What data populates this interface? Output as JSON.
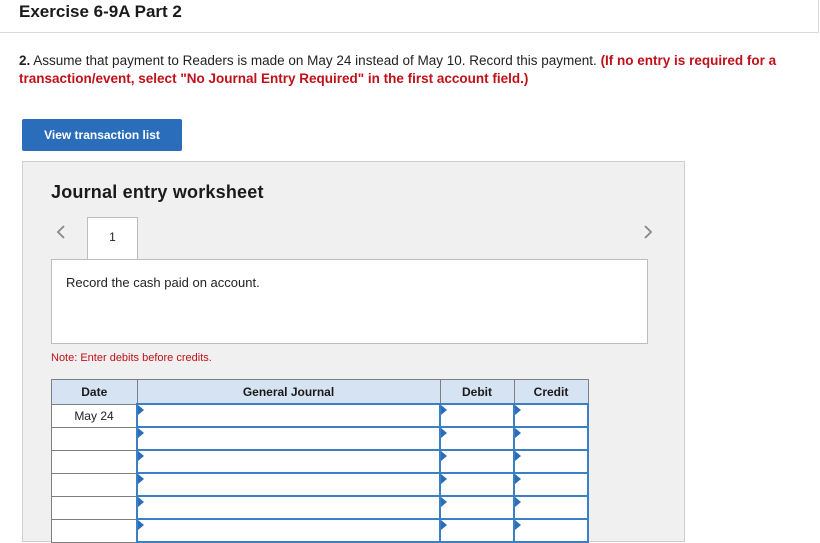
{
  "header": {
    "title": "Exercise 6-9A Part 2"
  },
  "instructions": {
    "number": "2.",
    "text": " Assume that payment to Readers is made on May 24 instead of May 10. Record this payment. ",
    "warning": "(If no entry is required for a transaction/event, select \"No Journal Entry Required\" in the first account field.)"
  },
  "view_button": {
    "label": "View transaction list"
  },
  "worksheet": {
    "title": "Journal entry worksheet",
    "current_tab": "1",
    "description": "Record the cash paid on account.",
    "note": "Note: Enter debits before credits.",
    "columns": [
      "Date",
      "General Journal",
      "Debit",
      "Credit"
    ],
    "rows": [
      {
        "date": "May 24",
        "account": "",
        "debit": "",
        "credit": ""
      },
      {
        "date": "",
        "account": "",
        "debit": "",
        "credit": ""
      },
      {
        "date": "",
        "account": "",
        "debit": "",
        "credit": ""
      },
      {
        "date": "",
        "account": "",
        "debit": "",
        "credit": ""
      },
      {
        "date": "",
        "account": "",
        "debit": "",
        "credit": ""
      },
      {
        "date": "",
        "account": "",
        "debit": "",
        "credit": ""
      }
    ]
  },
  "colors": {
    "accent": "#2a6ebb",
    "warning": "#c0101a",
    "table_header": "#d6e3f2"
  },
  "icons": {
    "prev": "chevron-left-icon",
    "next": "chevron-right-icon"
  }
}
